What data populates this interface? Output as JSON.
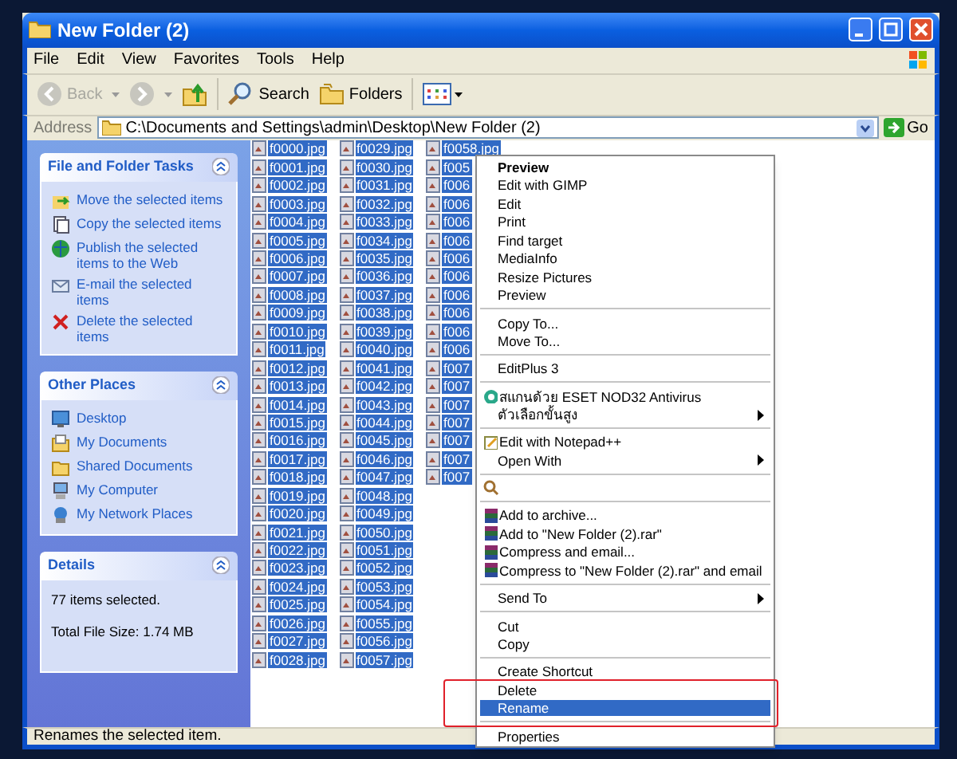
{
  "window": {
    "title": "New Folder (2)"
  },
  "menu_bar": [
    "File",
    "Edit",
    "View",
    "Favorites",
    "Tools",
    "Help"
  ],
  "toolbar": {
    "back": {
      "label": "Back",
      "disabled": true
    },
    "forward": {
      "disabled": true
    },
    "search": "Search",
    "folders": "Folders"
  },
  "address": {
    "label": "Address",
    "value": "C:\\Documents and Settings\\admin\\Desktop\\New Folder (2)",
    "go": "Go"
  },
  "sidebar": [
    {
      "kind": "links",
      "title": "File and Folder Tasks",
      "items": [
        "Move the selected items",
        "Copy the selected items",
        "Publish the selected items to the Web",
        "E-mail the selected items",
        "Delete the selected items"
      ]
    },
    {
      "kind": "links",
      "title": "Other Places",
      "items": [
        "Desktop",
        "My Documents",
        "Shared Documents",
        "My Computer",
        "My Network Places"
      ]
    },
    {
      "kind": "text",
      "title": "Details",
      "lines": [
        "77 items selected.",
        "Total File Size: 1.74 MB"
      ]
    }
  ],
  "files": [
    {
      "name": "f0000.jpg",
      "selected": true
    },
    {
      "name": "f0001.jpg",
      "selected": true
    },
    {
      "name": "f0002.jpg",
      "selected": true
    },
    {
      "name": "f0003.jpg",
      "selected": true
    },
    {
      "name": "f0004.jpg",
      "selected": true
    },
    {
      "name": "f0005.jpg",
      "selected": true
    },
    {
      "name": "f0006.jpg",
      "selected": true
    },
    {
      "name": "f0007.jpg",
      "selected": true
    },
    {
      "name": "f0008.jpg",
      "selected": true
    },
    {
      "name": "f0009.jpg",
      "selected": true
    },
    {
      "name": "f0010.jpg",
      "selected": true
    },
    {
      "name": "f0011.jpg",
      "selected": true
    },
    {
      "name": "f0012.jpg",
      "selected": true
    },
    {
      "name": "f0013.jpg",
      "selected": true
    },
    {
      "name": "f0014.jpg",
      "selected": true
    },
    {
      "name": "f0015.jpg",
      "selected": true
    },
    {
      "name": "f0016.jpg",
      "selected": true
    },
    {
      "name": "f0017.jpg",
      "selected": true
    },
    {
      "name": "f0018.jpg",
      "selected": true
    },
    {
      "name": "f0019.jpg",
      "selected": true
    },
    {
      "name": "f0020.jpg",
      "selected": true
    },
    {
      "name": "f0021.jpg",
      "selected": true
    },
    {
      "name": "f0022.jpg",
      "selected": true
    },
    {
      "name": "f0023.jpg",
      "selected": true
    },
    {
      "name": "f0024.jpg",
      "selected": true
    },
    {
      "name": "f0025.jpg",
      "selected": true
    },
    {
      "name": "f0026.jpg",
      "selected": true
    },
    {
      "name": "f0027.jpg",
      "selected": true
    },
    {
      "name": "f0028.jpg",
      "selected": true
    },
    {
      "name": "f0029.jpg",
      "selected": true
    },
    {
      "name": "f0030.jpg",
      "selected": true
    },
    {
      "name": "f0031.jpg",
      "selected": true
    },
    {
      "name": "f0032.jpg",
      "selected": true
    },
    {
      "name": "f0033.jpg",
      "selected": true
    },
    {
      "name": "f0034.jpg",
      "selected": true
    },
    {
      "name": "f0035.jpg",
      "selected": true
    },
    {
      "name": "f0036.jpg",
      "selected": true
    },
    {
      "name": "f0037.jpg",
      "selected": true
    },
    {
      "name": "f0038.jpg",
      "selected": true
    },
    {
      "name": "f0039.jpg",
      "selected": true
    },
    {
      "name": "f0040.jpg",
      "selected": true
    },
    {
      "name": "f0041.jpg",
      "selected": true
    },
    {
      "name": "f0042.jpg",
      "selected": true
    },
    {
      "name": "f0043.jpg",
      "selected": true
    },
    {
      "name": "f0044.jpg",
      "selected": true
    },
    {
      "name": "f0045.jpg",
      "selected": true
    },
    {
      "name": "f0046.jpg",
      "selected": true
    },
    {
      "name": "f0047.jpg",
      "selected": true
    },
    {
      "name": "f0048.jpg",
      "selected": true
    },
    {
      "name": "f0049.jpg",
      "selected": true
    },
    {
      "name": "f0050.jpg",
      "selected": true
    },
    {
      "name": "f0051.jpg",
      "selected": true
    },
    {
      "name": "f0052.jpg",
      "selected": true
    },
    {
      "name": "f0053.jpg",
      "selected": true
    },
    {
      "name": "f0054.jpg",
      "selected": true
    },
    {
      "name": "f0055.jpg",
      "selected": true
    },
    {
      "name": "f0056.jpg",
      "selected": true
    },
    {
      "name": "f0057.jpg",
      "selected": true
    },
    {
      "name": "f0058.jpg",
      "selected": true
    },
    {
      "name": "f005",
      "selected": true
    },
    {
      "name": "f006",
      "selected": true
    },
    {
      "name": "f006",
      "selected": true
    },
    {
      "name": "f006",
      "selected": true
    },
    {
      "name": "f006",
      "selected": true
    },
    {
      "name": "f006",
      "selected": true
    },
    {
      "name": "f006",
      "selected": true
    },
    {
      "name": "f006",
      "selected": true
    },
    {
      "name": "f006",
      "selected": true
    },
    {
      "name": "f006",
      "selected": true
    },
    {
      "name": "f006",
      "selected": true
    },
    {
      "name": "f007",
      "selected": true
    },
    {
      "name": "f007",
      "selected": true
    },
    {
      "name": "f007",
      "selected": true
    },
    {
      "name": "f007",
      "selected": true
    },
    {
      "name": "f007",
      "selected": true
    },
    {
      "name": "f007",
      "selected": true
    },
    {
      "name": "f007",
      "selected": true
    }
  ],
  "context_menu": [
    {
      "kind": "plain",
      "label": "Preview",
      "bold": true,
      "selected": false
    },
    {
      "kind": "plain",
      "label": "Edit with GIMP",
      "selected": false
    },
    {
      "kind": "plain",
      "label": "Edit",
      "selected": false
    },
    {
      "kind": "plain",
      "label": "Print",
      "selected": false
    },
    {
      "kind": "plain",
      "label": "Find target",
      "selected": false
    },
    {
      "kind": "plain",
      "label": "MediaInfo",
      "selected": false
    },
    {
      "kind": "plain",
      "label": "Resize Pictures",
      "selected": false
    },
    {
      "kind": "plain",
      "label": "Preview",
      "selected": false
    },
    {
      "kind": "separator"
    },
    {
      "kind": "plain",
      "label": "Copy To...",
      "selected": false
    },
    {
      "kind": "plain",
      "label": "Move To...",
      "selected": false
    },
    {
      "kind": "separator"
    },
    {
      "kind": "plain",
      "label": "EditPlus 3",
      "selected": false
    },
    {
      "kind": "separator"
    },
    {
      "kind": "antivirus",
      "label": "สแกนด้วย ESET NOD32 Antivirus",
      "selected": false
    },
    {
      "kind": "plain",
      "label": "ตัวเลือกขั้นสูง",
      "submenu": true,
      "selected": false
    },
    {
      "kind": "separator"
    },
    {
      "kind": "notepad",
      "label": "Edit with Notepad++",
      "selected": false
    },
    {
      "kind": "plain",
      "label": "Open With",
      "submenu": true,
      "selected": false
    },
    {
      "kind": "separator"
    },
    {
      "kind": "covered"
    },
    {
      "kind": "separator"
    },
    {
      "kind": "archive",
      "label": "Add to archive...",
      "selected": false
    },
    {
      "kind": "archive",
      "label": "Add to \"New Folder (2).rar\"",
      "selected": false
    },
    {
      "kind": "archive",
      "label": "Compress and email...",
      "selected": false
    },
    {
      "kind": "archive",
      "label": "Compress to \"New Folder (2).rar\" and email",
      "selected": false
    },
    {
      "kind": "separator"
    },
    {
      "kind": "plain",
      "label": "Send To",
      "submenu": true,
      "selected": false
    },
    {
      "kind": "separator"
    },
    {
      "kind": "plain",
      "label": "Cut",
      "selected": false
    },
    {
      "kind": "plain",
      "label": "Copy",
      "selected": false
    },
    {
      "kind": "separator"
    },
    {
      "kind": "plain",
      "label": "Create Shortcut",
      "selected": false
    },
    {
      "kind": "plain",
      "label": "Delete",
      "selected": false
    },
    {
      "kind": "plain",
      "label": "Rename",
      "selected": true
    },
    {
      "kind": "separator"
    },
    {
      "kind": "plain",
      "label": "Properties",
      "selected": false
    }
  ],
  "status_bar": "Renames the selected item."
}
